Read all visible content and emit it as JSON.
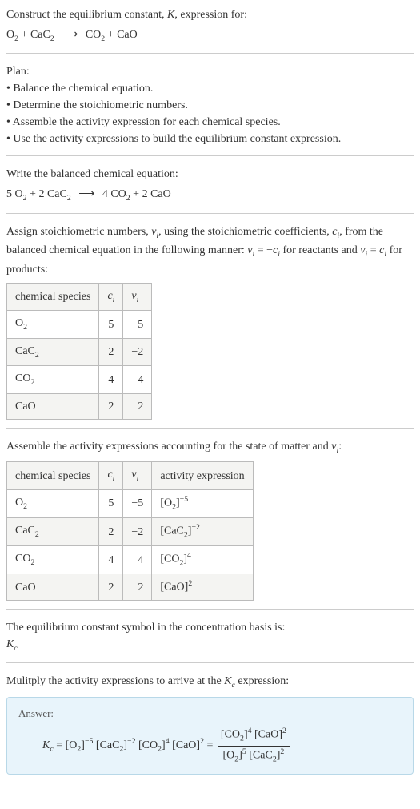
{
  "intro": {
    "line1": "Construct the equilibrium constant, ",
    "k": "K",
    "line1b": ", expression for:",
    "eq_lhs1": "O",
    "eq_lhs1_sub": "2",
    "plus": " + ",
    "eq_lhs2": "CaC",
    "eq_lhs2_sub": "2",
    "arrow": "⟶",
    "eq_rhs1": "CO",
    "eq_rhs1_sub": "2",
    "eq_rhs2": "CaO"
  },
  "plan": {
    "title": "Plan:",
    "b1": "• Balance the chemical equation.",
    "b2": "• Determine the stoichiometric numbers.",
    "b3": "• Assemble the activity expression for each chemical species.",
    "b4": "• Use the activity expressions to build the equilibrium constant expression."
  },
  "balanced": {
    "title": "Write the balanced chemical equation:",
    "c1": "5 ",
    "s1": "O",
    "s1sub": "2",
    "plus": " + ",
    "c2": "2 ",
    "s2": "CaC",
    "s2sub": "2",
    "arrow": "⟶",
    "c3": "4 ",
    "s3": "CO",
    "s3sub": "2",
    "c4": "2 ",
    "s4": "CaO"
  },
  "assign": {
    "t1": "Assign stoichiometric numbers, ",
    "vi": "ν",
    "visub": "i",
    "t2": ", using the stoichiometric coefficients, ",
    "ci": "c",
    "cisub": "i",
    "t3": ", from the balanced chemical equation in the following manner: ",
    "rel1a": "ν",
    "rel1a_sub": "i",
    "rel1eq": " = −",
    "rel1b": "c",
    "rel1b_sub": "i",
    "t4": " for reactants and ",
    "rel2a": "ν",
    "rel2a_sub": "i",
    "rel2eq": " = ",
    "rel2b": "c",
    "rel2b_sub": "i",
    "t5": " for products:",
    "h1": "chemical species",
    "h2": "c",
    "h2sub": "i",
    "h3": "ν",
    "h3sub": "i",
    "r1s": "O",
    "r1sub": "2",
    "r1c": "5",
    "r1v": "−5",
    "r2s": "CaC",
    "r2sub": "2",
    "r2c": "2",
    "r2v": "−2",
    "r3s": "CO",
    "r3sub": "2",
    "r3c": "4",
    "r3v": "4",
    "r4s": "CaO",
    "r4c": "2",
    "r4v": "2"
  },
  "activity": {
    "t1": "Assemble the activity expressions accounting for the state of matter and ",
    "vi": "ν",
    "visub": "i",
    "t2": ":",
    "h1": "chemical species",
    "h2": "c",
    "h2sub": "i",
    "h3": "ν",
    "h3sub": "i",
    "h4": "activity expression",
    "r1s": "O",
    "r1sub": "2",
    "r1c": "5",
    "r1v": "−5",
    "r1a": "[O",
    "r1asub": "2",
    "r1ab": "]",
    "r1asup": "−5",
    "r2s": "CaC",
    "r2sub": "2",
    "r2c": "2",
    "r2v": "−2",
    "r2a": "[CaC",
    "r2asub": "2",
    "r2ab": "]",
    "r2asup": "−2",
    "r3s": "CO",
    "r3sub": "2",
    "r3c": "4",
    "r3v": "4",
    "r3a": "[CO",
    "r3asub": "2",
    "r3ab": "]",
    "r3asup": "4",
    "r4s": "CaO",
    "r4c": "2",
    "r4v": "2",
    "r4a": "[CaO]",
    "r4asup": "2"
  },
  "symbol": {
    "t1": "The equilibrium constant symbol in the concentration basis is:",
    "kc": "K",
    "kcsub": "c"
  },
  "mult": {
    "t1": "Mulitply the activity expressions to arrive at the ",
    "kc": "K",
    "kcsub": "c",
    "t2": " expression:"
  },
  "answer": {
    "label": "Answer:",
    "kc": "K",
    "kcsub": "c",
    "eq": " = ",
    "p1": "[O",
    "p1sub": "2",
    "p1b": "]",
    "p1sup": "−5",
    "sp": " ",
    "p2": "[CaC",
    "p2sub": "2",
    "p2b": "]",
    "p2sup": "−2",
    "p3": "[CO",
    "p3sub": "2",
    "p3b": "]",
    "p3sup": "4",
    "p4": "[CaO]",
    "p4sup": "2",
    "eq2": " = ",
    "n1": "[CO",
    "n1sub": "2",
    "n1b": "]",
    "n1sup": "4",
    "n2": "[CaO]",
    "n2sup": "2",
    "d1": "[O",
    "d1sub": "2",
    "d1b": "]",
    "d1sup": "5",
    "d2": "[CaC",
    "d2sub": "2",
    "d2b": "]",
    "d2sup": "2"
  },
  "chart_data": {
    "type": "table",
    "tables": [
      {
        "title": "stoichiometric numbers",
        "columns": [
          "chemical species",
          "c_i",
          "ν_i"
        ],
        "rows": [
          [
            "O2",
            5,
            -5
          ],
          [
            "CaC2",
            2,
            -2
          ],
          [
            "CO2",
            4,
            4
          ],
          [
            "CaO",
            2,
            2
          ]
        ]
      },
      {
        "title": "activity expressions",
        "columns": [
          "chemical species",
          "c_i",
          "ν_i",
          "activity expression"
        ],
        "rows": [
          [
            "O2",
            5,
            -5,
            "[O2]^-5"
          ],
          [
            "CaC2",
            2,
            -2,
            "[CaC2]^-2"
          ],
          [
            "CO2",
            4,
            4,
            "[CO2]^4"
          ],
          [
            "CaO",
            2,
            2,
            "[CaO]^2"
          ]
        ]
      }
    ]
  }
}
